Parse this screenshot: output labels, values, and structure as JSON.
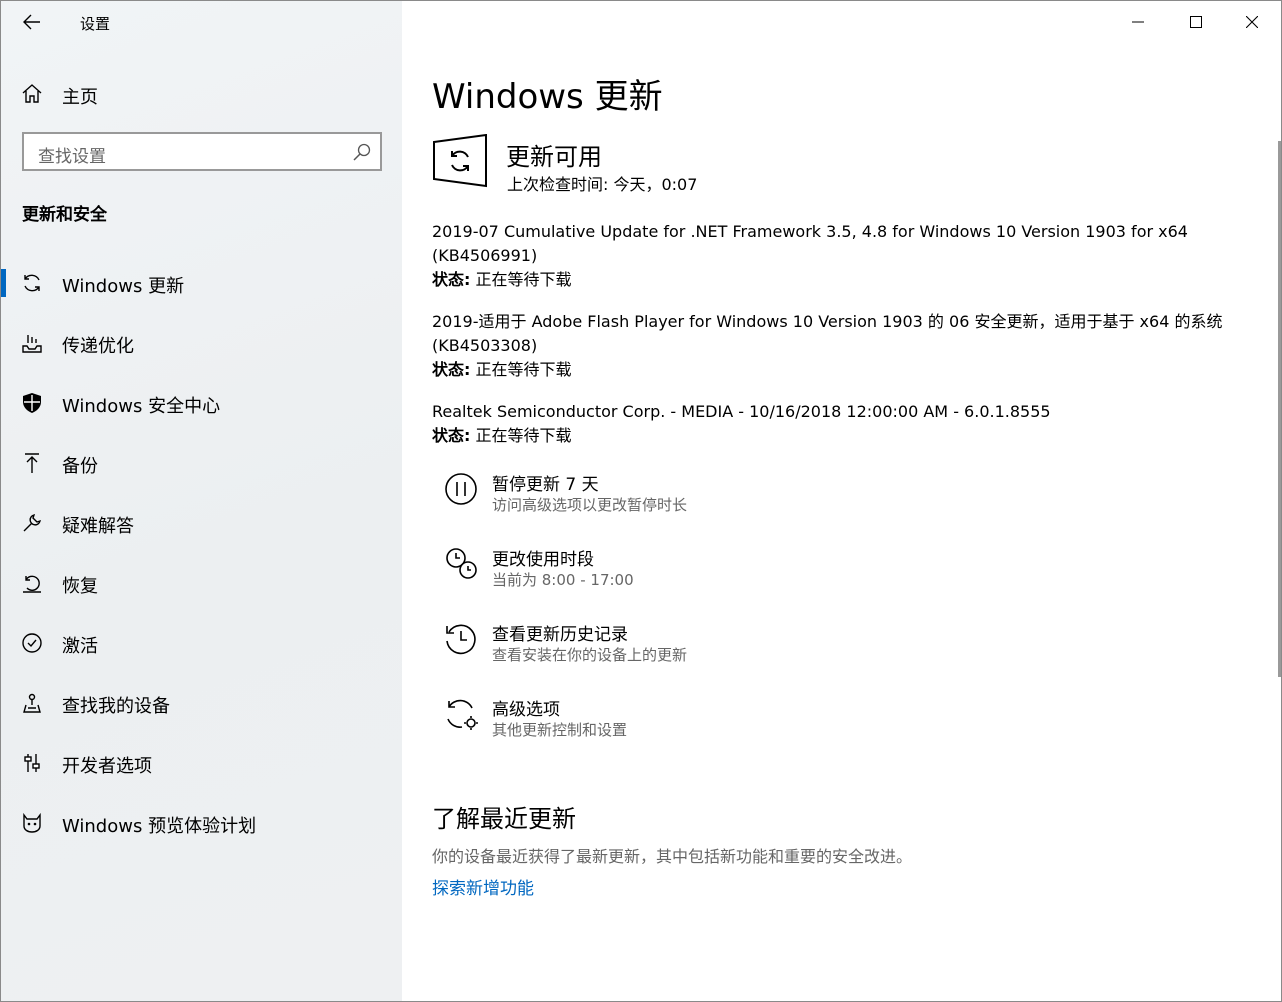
{
  "app": {
    "title": "设置"
  },
  "sidebar": {
    "home_label": "主页",
    "search_placeholder": "查找设置",
    "section_title": "更新和安全",
    "items": [
      {
        "label": "Windows 更新",
        "icon": "sync-icon",
        "active": true
      },
      {
        "label": "传递优化",
        "icon": "delivery-optimization-icon"
      },
      {
        "label": "Windows 安全中心",
        "icon": "shield-icon"
      },
      {
        "label": "备份",
        "icon": "backup-arrow-icon"
      },
      {
        "label": "疑难解答",
        "icon": "wrench-icon"
      },
      {
        "label": "恢复",
        "icon": "recovery-icon"
      },
      {
        "label": "激活",
        "icon": "check-circle-icon"
      },
      {
        "label": "查找我的设备",
        "icon": "find-device-icon"
      },
      {
        "label": "开发者选项",
        "icon": "developer-sliders-icon"
      },
      {
        "label": "Windows 预览体验计划",
        "icon": "insider-cat-icon"
      }
    ]
  },
  "main": {
    "title": "Windows 更新",
    "status": {
      "heading": "更新可用",
      "last_check": "上次检查时间: 今天，0:07"
    },
    "status_label": "状态:",
    "updates": [
      {
        "name": "2019-07 Cumulative Update for .NET Framework 3.5, 4.8 for Windows 10 Version 1903 for x64 (KB4506991)",
        "status": "正在等待下载"
      },
      {
        "name": "2019-适用于 Adobe Flash Player for Windows 10 Version 1903 的 06 安全更新，适用于基于 x64 的系统 (KB4503308)",
        "status": "正在等待下载"
      },
      {
        "name": "Realtek Semiconductor Corp. - MEDIA - 10/16/2018 12:00:00 AM - 6.0.1.8555",
        "status": "正在等待下载"
      }
    ],
    "options": [
      {
        "title": "暂停更新 7 天",
        "subtitle": "访问高级选项以更改暂停时长",
        "icon": "pause-icon"
      },
      {
        "title": "更改使用时段",
        "subtitle": "当前为 8:00 - 17:00",
        "icon": "active-hours-clock-icon"
      },
      {
        "title": "查看更新历史记录",
        "subtitle": "查看安装在你的设备上的更新",
        "icon": "history-icon"
      },
      {
        "title": "高级选项",
        "subtitle": "其他更新控制和设置",
        "icon": "advanced-sync-gear-icon"
      }
    ],
    "learn": {
      "title": "了解最近更新",
      "description": "你的设备最近获得了最新更新，其中包括新功能和重要的安全改进。",
      "link": "探索新增功能"
    }
  },
  "colors": {
    "accent": "#0067c0",
    "sidebar_bg": "#eef1f3",
    "secondary_text": "#666666"
  }
}
